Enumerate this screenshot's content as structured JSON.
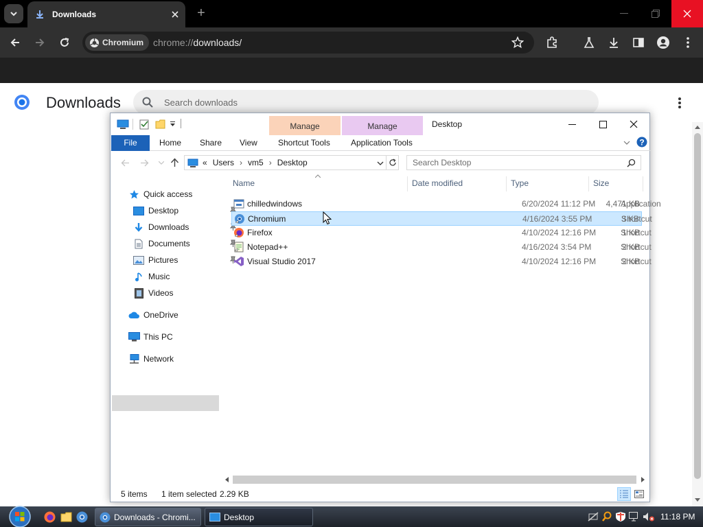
{
  "browser": {
    "tab_title": "Downloads",
    "omnibox_chip": "Chromium",
    "url_scheme": "chrome://",
    "url_path": "downloads/"
  },
  "downloads_page": {
    "title": "Downloads",
    "search_placeholder": "Search downloads"
  },
  "explorer": {
    "title": "Desktop",
    "context_tabs": [
      {
        "label": "Manage",
        "color": "#fbd3b9"
      },
      {
        "label": "Manage",
        "color": "#e9c9f1"
      }
    ],
    "ribbon_tabs": [
      "File",
      "Home",
      "Share",
      "View",
      "Shortcut Tools",
      "Application Tools"
    ],
    "breadcrumb": [
      "«",
      "Users",
      "vm5",
      "Desktop"
    ],
    "search_placeholder": "Search Desktop",
    "nav": {
      "quick_access": "Quick access",
      "quick_items": [
        "Desktop",
        "Downloads",
        "Documents",
        "Pictures",
        "Music",
        "Videos"
      ],
      "onedrive": "OneDrive",
      "this_pc": "This PC",
      "network": "Network"
    },
    "columns": [
      "Name",
      "Date modified",
      "Type",
      "Size"
    ],
    "files": [
      {
        "name": "chilledwindows",
        "date": "6/20/2024 11:12 PM",
        "type": "Application",
        "size": "4,471 KB",
        "icon": "application-icon"
      },
      {
        "name": "Chromium",
        "date": "4/16/2024 3:55 PM",
        "type": "Shortcut",
        "size": "3 KB",
        "icon": "chromium-icon"
      },
      {
        "name": "Firefox",
        "date": "4/10/2024 12:16 PM",
        "type": "Shortcut",
        "size": "1 KB",
        "icon": "firefox-icon"
      },
      {
        "name": "Notepad++",
        "date": "4/16/2024 3:54 PM",
        "type": "Shortcut",
        "size": "2 KB",
        "icon": "notepadpp-icon"
      },
      {
        "name": "Visual Studio 2017",
        "date": "4/10/2024 12:16 PM",
        "type": "Shortcut",
        "size": "2 KB",
        "icon": "visual-studio-icon"
      }
    ],
    "selected_file": "Chromium",
    "status": {
      "items": "5 items",
      "selected": "1 item selected",
      "size": "2.29 KB"
    }
  },
  "taskbar": {
    "buttons": [
      "Downloads - Chromi...",
      "Desktop"
    ],
    "clock": "11:18 PM"
  }
}
